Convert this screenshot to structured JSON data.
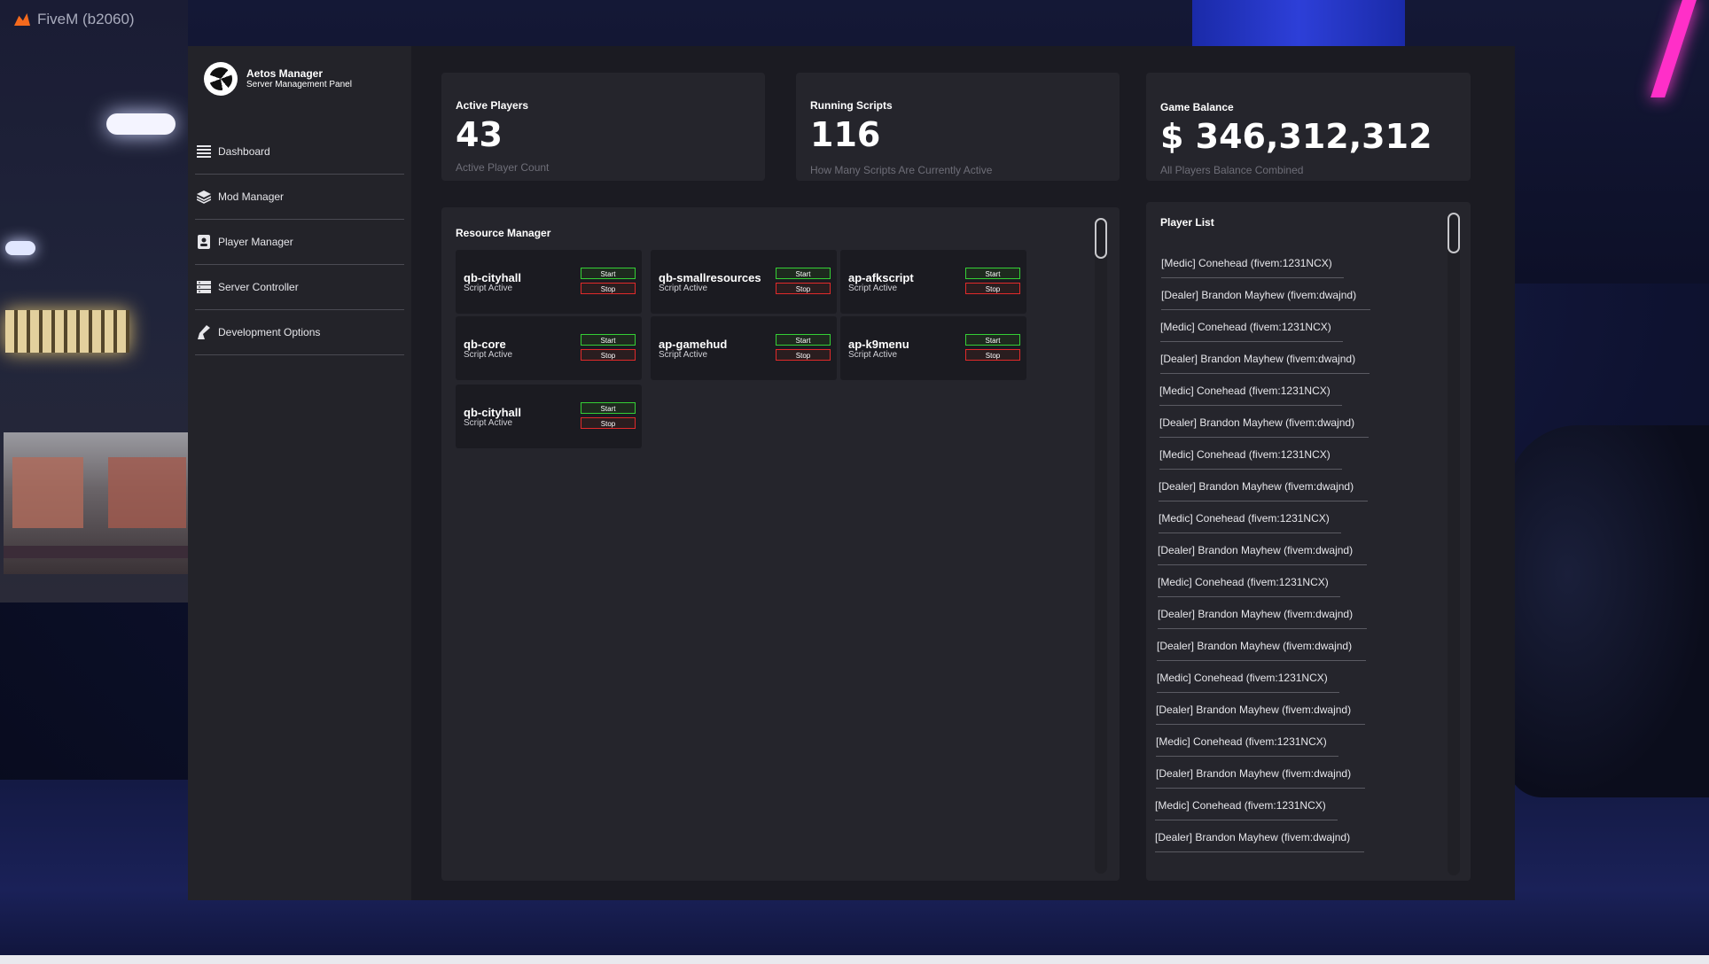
{
  "window": {
    "title": "FiveM (b2060)"
  },
  "brand": {
    "name": "Aetos Manager",
    "subtitle": "Server Management Panel"
  },
  "nav": [
    {
      "label": "Dashboard",
      "icon": "list-icon"
    },
    {
      "label": "Mod Manager",
      "icon": "layers-icon"
    },
    {
      "label": "Player Manager",
      "icon": "contact-card-icon"
    },
    {
      "label": "Server Controller",
      "icon": "server-icon"
    },
    {
      "label": "Development Options",
      "icon": "flask-icon"
    }
  ],
  "stats": {
    "players": {
      "label": "Active Players",
      "value": "43",
      "sub": "Active Player Count"
    },
    "scripts": {
      "label": "Running Scripts",
      "value": "116",
      "sub": "How Many Scripts Are Currently Active"
    },
    "balance": {
      "label": "Game Balance",
      "value": "$ 346,312,312",
      "sub": "All Players Balance Combined"
    }
  },
  "resources": {
    "title": "Resource Manager",
    "start_label": "Start",
    "stop_label": "Stop",
    "items": [
      {
        "name": "qb-cityhall",
        "status": "Script Active"
      },
      {
        "name": "qb-smallresources",
        "status": "Script Active"
      },
      {
        "name": "ap-afkscript",
        "status": "Script Active"
      },
      {
        "name": "qb-core",
        "status": "Script Active"
      },
      {
        "name": "ap-gamehud",
        "status": "Script Active"
      },
      {
        "name": "ap-k9menu",
        "status": "Script Active"
      },
      {
        "name": "qb-cityhall",
        "status": "Script Active"
      }
    ]
  },
  "players": {
    "title": "Player List",
    "items": [
      "[Medic] Conehead (fivem:1231NCX)",
      "[Dealer] Brandon Mayhew (fivem:dwajnd)",
      "[Medic] Conehead (fivem:1231NCX)",
      "[Dealer] Brandon Mayhew (fivem:dwajnd)",
      "[Medic] Conehead (fivem:1231NCX)",
      "[Dealer] Brandon Mayhew (fivem:dwajnd)",
      "[Medic] Conehead (fivem:1231NCX)",
      "[Dealer] Brandon Mayhew (fivem:dwajnd)",
      "[Medic] Conehead (fivem:1231NCX)",
      "[Dealer] Brandon Mayhew (fivem:dwajnd)",
      "[Medic] Conehead (fivem:1231NCX)",
      "[Dealer] Brandon Mayhew (fivem:dwajnd)",
      "[Dealer] Brandon Mayhew (fivem:dwajnd)",
      "[Medic] Conehead (fivem:1231NCX)",
      "[Dealer] Brandon Mayhew (fivem:dwajnd)",
      "[Medic] Conehead (fivem:1231NCX)",
      "[Dealer] Brandon Mayhew (fivem:dwajnd)",
      "[Medic] Conehead (fivem:1231NCX)",
      "[Dealer] Brandon Mayhew (fivem:dwajnd)"
    ]
  },
  "colors": {
    "start": "#35d035",
    "stop": "#e12a2a",
    "panel": "#1b1b22",
    "card": "#25252c"
  }
}
